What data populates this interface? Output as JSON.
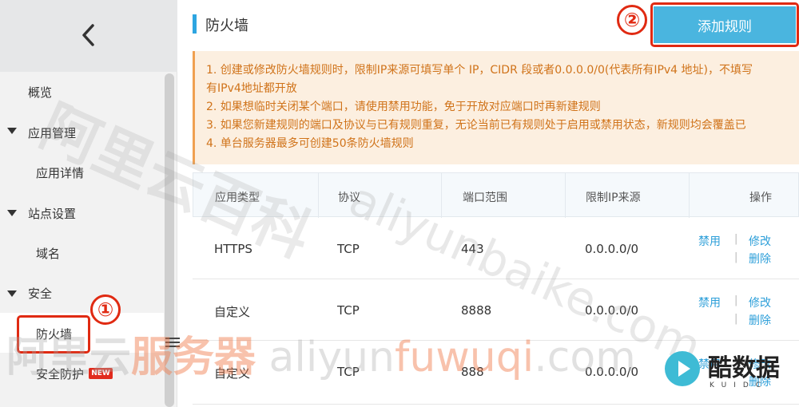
{
  "sidebar": {
    "overview": "概览",
    "app_mgmt": "应用管理",
    "app_detail": "应用详情",
    "site_settings": "站点设置",
    "domain": "域名",
    "security": "安全",
    "firewall": "防火墙",
    "security_protect": "安全防护",
    "new_badge": "NEW"
  },
  "annotations": {
    "one": "①",
    "two": "②"
  },
  "header": {
    "title": "防火墙",
    "add_button": "添加规则"
  },
  "notice": {
    "lines": [
      "1. 创建或修改防火墙规则时，限制IP来源可填写单个 IP，CIDR 段或者0.0.0.0/0(代表所有IPv4 地址)，不填写",
      "有IPv4地址都开放",
      "2. 如果想临时关闭某个端口，请使用禁用功能，免于开放对应端口时再新建规则",
      "3. 如果您新建规则的端口及协议与已有规则重复，无论当前已有规则处于启用或禁用状态，新规则均会覆盖已",
      "4. 单台服务器最多可创建50条防火墙规则"
    ]
  },
  "table": {
    "headers": [
      "应用类型",
      "协议",
      "端口范围",
      "限制IP来源",
      "操作"
    ],
    "rows": [
      {
        "app": "HTTPS",
        "protocol": "TCP",
        "port": "443",
        "ip": "0.0.0.0/0",
        "disable": "禁用",
        "modify": "修改",
        "delete": "删除"
      },
      {
        "app": "自定义",
        "protocol": "TCP",
        "port": "8888",
        "ip": "0.0.0.0/0",
        "disable": "禁用",
        "modify": "修改",
        "delete": "删除"
      },
      {
        "app": "自定义",
        "protocol": "TCP",
        "port": "888",
        "ip": "0.0.0.0/0",
        "disable": "禁用",
        "modify": "修改",
        "delete": "删除"
      }
    ]
  },
  "watermarks": {
    "wm1": "阿里云百科",
    "wm2": "aliyunbaike.com",
    "wm3a": "阿里云",
    "wm3b": "服务器",
    "wm3c": " aliyun",
    "wm3d": "fuwuqi",
    "wm3e": ".com"
  },
  "logo": {
    "text": "酷数据",
    "sub": "KUIDC"
  }
}
